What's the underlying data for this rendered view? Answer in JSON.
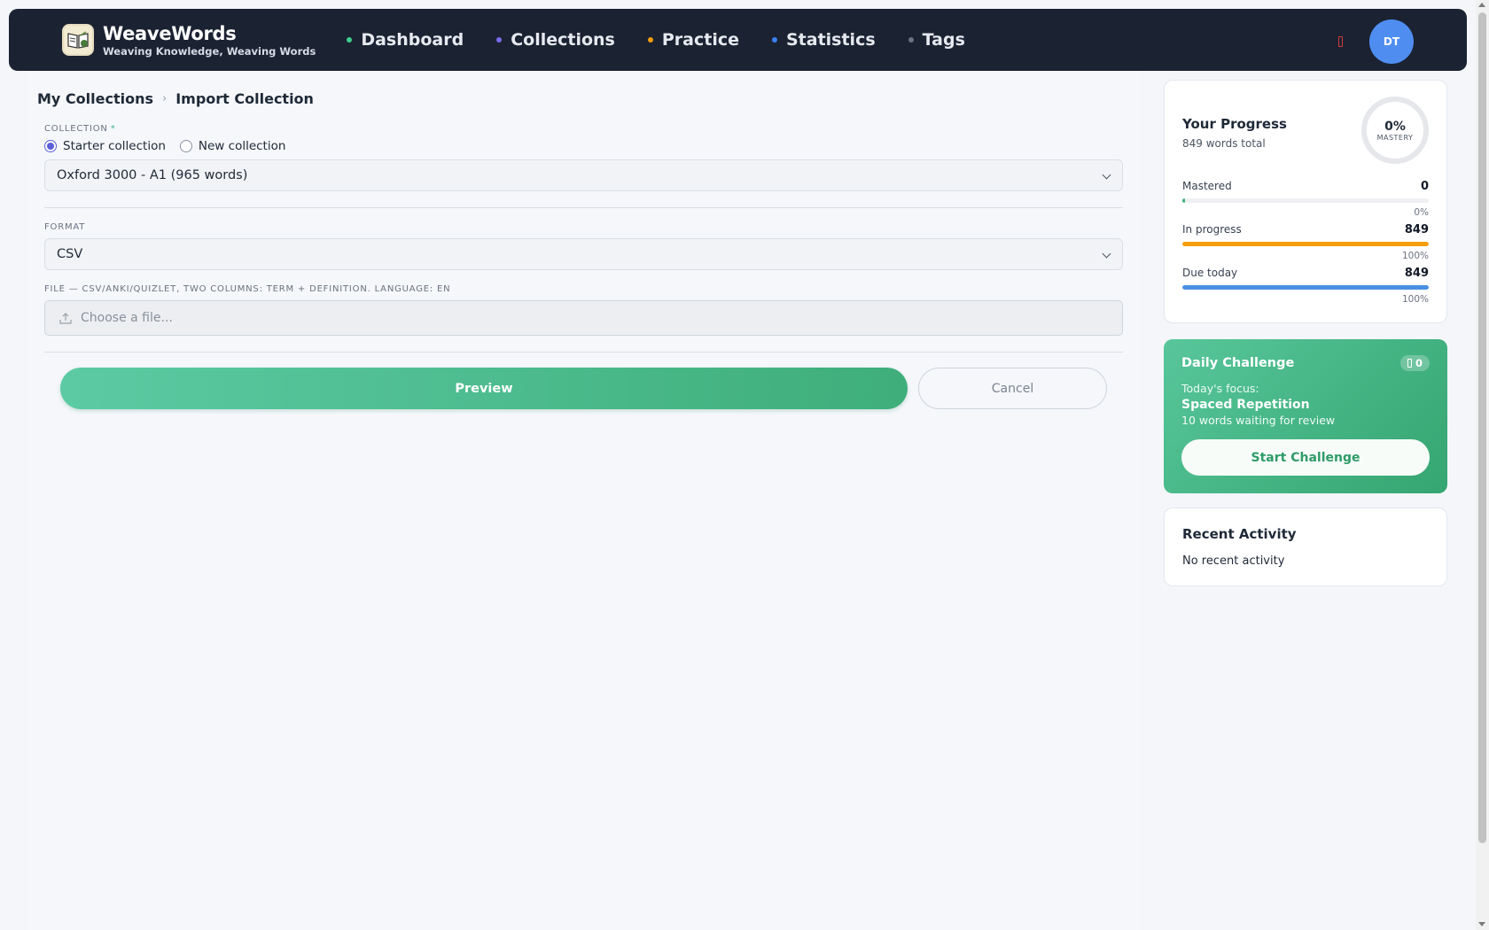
{
  "app": {
    "name": "WeaveWords",
    "tagline": "Weaving Knowledge, Weaving Words",
    "avatar_initials": "DT"
  },
  "nav": {
    "items": [
      {
        "label": "Dashboard",
        "dot_color": "#3ecf8e"
      },
      {
        "label": "Collections",
        "dot_color": "#7b6cf0"
      },
      {
        "label": "Practice",
        "dot_color": "#f59e0b"
      },
      {
        "label": "Statistics",
        "dot_color": "#3b82f6"
      },
      {
        "label": "Tags",
        "dot_color": "#6b7280"
      }
    ]
  },
  "breadcrumb": {
    "parent": "My Collections",
    "current": "Import Collection"
  },
  "form": {
    "collection_label": "COLLECTION",
    "required_mark": "*",
    "radio_starter": "Starter collection",
    "radio_new": "New collection",
    "selected_radio": "starter",
    "collection_value": "Oxford 3000 - A1 (965 words)",
    "format_label": "FORMAT",
    "format_value": "CSV",
    "file_label": "FILE — CSV/ANKI/QUIZLET, TWO COLUMNS: TERM + DEFINITION. LANGUAGE: EN",
    "file_placeholder": "Choose a file...",
    "preview_button": "Preview",
    "cancel_button": "Cancel"
  },
  "progress": {
    "title": "Your Progress",
    "words_total": "849 words total",
    "mastery_value": "0%",
    "mastery_label": "MASTERY",
    "stats": [
      {
        "label": "Mastered",
        "count": "0",
        "percent": "0%",
        "fraction": 0.01,
        "color": "#3fae7a"
      },
      {
        "label": "In progress",
        "count": "849",
        "percent": "100%",
        "fraction": 1.0,
        "color": "#f59e0b"
      },
      {
        "label": "Due today",
        "count": "849",
        "percent": "100%",
        "fraction": 1.0,
        "color": "#4a90e2"
      }
    ]
  },
  "challenge": {
    "title": "Daily Challenge",
    "streak": "0",
    "focus_label": "Today's focus:",
    "topic": "Spaced Repetition",
    "subtitle": "10 words waiting for review",
    "button": "Start Challenge"
  },
  "recent": {
    "title": "Recent Activity",
    "empty_text": "No recent activity"
  }
}
